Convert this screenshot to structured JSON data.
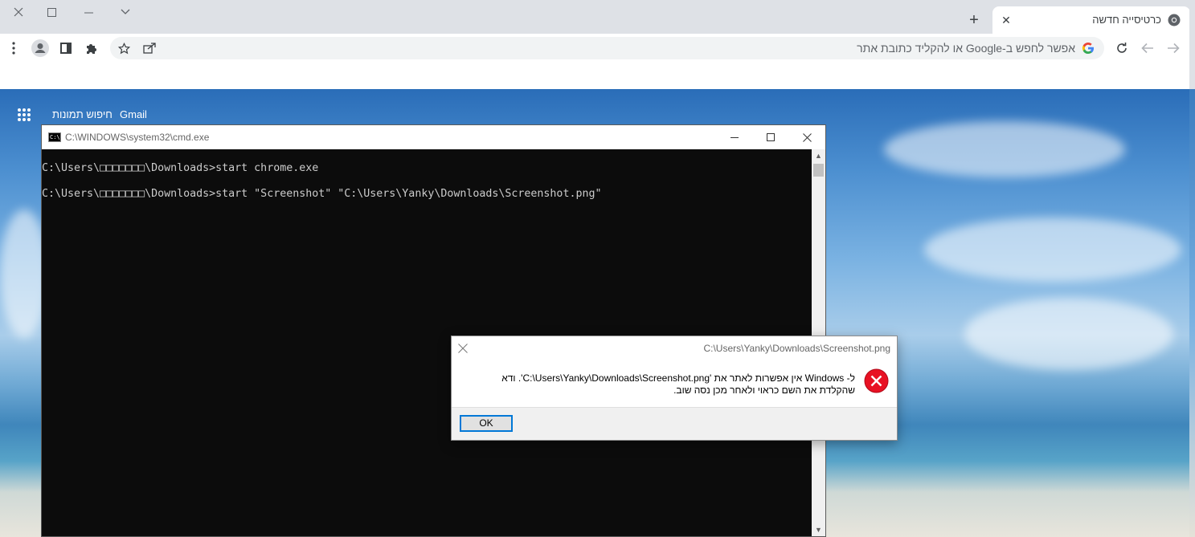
{
  "browser": {
    "tab": {
      "title": "כרטיסייה חדשה",
      "close": "✕"
    },
    "new_tab": "+",
    "omnibox": {
      "placeholder": "אפשר לחפש ב-Google או להקליד כתובת אתר"
    }
  },
  "page": {
    "links": {
      "gmail": "Gmail",
      "images": "חיפוש תמונות"
    }
  },
  "cmd": {
    "title": "C:\\WINDOWS\\system32\\cmd.exe",
    "icon_text": "C:\\",
    "lines": [
      "C:\\Users\\□□□□□□□\\Downloads>start chrome.exe",
      "C:\\Users\\□□□□□□□\\Downloads>start \"Screenshot\" \"C:\\Users\\Yanky\\Downloads\\Screenshot.png\""
    ]
  },
  "dialog": {
    "title": "C:\\Users\\Yanky\\Downloads\\Screenshot.png",
    "message_line1": "ל- Windows אין אפשרות לאתר את 'C:\\Users\\Yanky\\Downloads\\Screenshot.png'. ודא",
    "message_line2": "שהקלדת את השם כראוי ולאחר מכן נסה שוב.",
    "ok_label": "OK",
    "icon": "error-icon"
  },
  "colors": {
    "dialog_ok_border": "#0078d7",
    "error_red": "#e81123",
    "cmd_background": "#0c0c0c"
  }
}
